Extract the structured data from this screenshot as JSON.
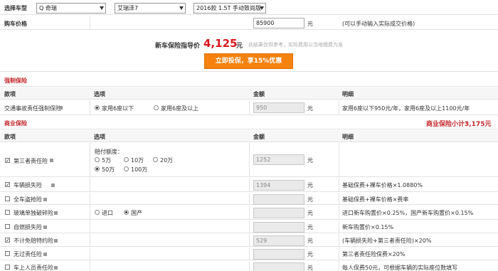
{
  "top": {
    "label": "选择车型",
    "brand": "Q 奇瑞",
    "series": "艾瑞泽7",
    "model": "2016款 1.5T 手动致尚版"
  },
  "price": {
    "label": "购车价格",
    "value": "85900",
    "unit": "元",
    "hint": "(可以手动输入实际成交价格)"
  },
  "guide": {
    "label": "新车保险指导价",
    "value": "4,125",
    "unit": "元",
    "note": "此结果仅供参考，实际费用以当地缴费为准",
    "button": "立即投保，享15%优惠"
  },
  "mandatory": {
    "title": "强制保险",
    "headers": [
      "款项",
      "选项",
      "金额",
      "明细"
    ],
    "item": "交通事故责任强制保险",
    "opt1": "家用6座以下",
    "opt2": "家用6座及以上",
    "amount": "950",
    "unit": "元",
    "detail": "家用6座以下950元/年，家用6座及以上1100元/年"
  },
  "commercial": {
    "title": "商业保险",
    "subtotal_label": "商业保险小计：",
    "subtotal_value": "3,175元",
    "headers": [
      "款项",
      "选项",
      "金额",
      "明细"
    ],
    "third_party": {
      "name": "第三者责任险",
      "limit_label": "赔付额度：",
      "options": [
        "5万",
        "10万",
        "20万",
        "50万",
        "100万"
      ],
      "amount": "1252",
      "unit": "元"
    },
    "rows": [
      {
        "name": "车辆损失险",
        "checked": true,
        "amount": "1394",
        "unit": "元",
        "detail": "基础保费+裸车价格×1.0880%"
      },
      {
        "name": "全车盗抢险",
        "checked": false,
        "amount": "",
        "unit": "元",
        "detail": "基础保费+裸车价格×费率"
      },
      {
        "name": "玻璃单独破碎险",
        "checked": false,
        "amount": "",
        "unit": "元",
        "detail": "进口新车购置价×0.25%，国产新车购置价×0.15%"
      },
      {
        "name": "自燃损失险",
        "checked": false,
        "amount": "",
        "unit": "元",
        "detail": "新车购置价×0.15%"
      },
      {
        "name": "不计免赔特约险",
        "checked": true,
        "amount": "529",
        "unit": "元",
        "detail": "(车辆损失险+第三者责任险)×20%"
      },
      {
        "name": "无过责任险",
        "checked": false,
        "amount": "",
        "unit": "元",
        "detail": "第三者责任险保费×20%"
      },
      {
        "name": "车上人员责任险",
        "checked": false,
        "amount": "",
        "unit": "元",
        "detail": "每人保费50元，可根据车辆的实际座位数填写"
      }
    ],
    "glass_options": [
      "进口",
      "国产"
    ]
  }
}
